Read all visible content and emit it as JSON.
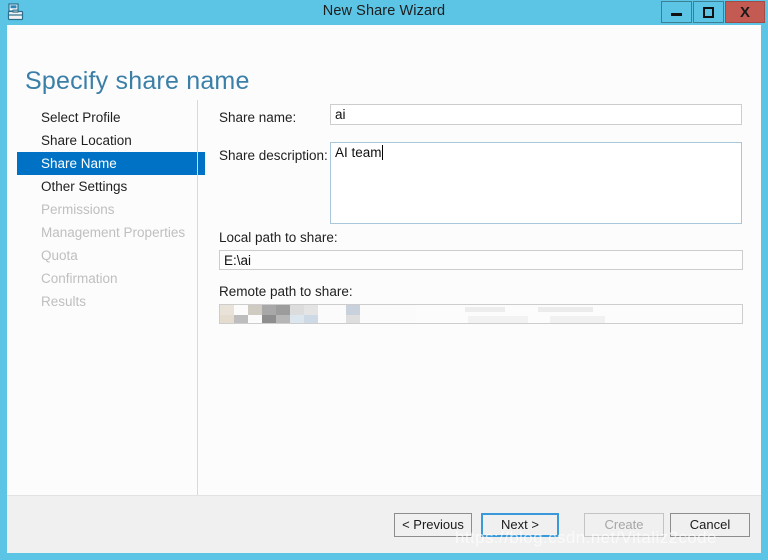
{
  "window": {
    "title": "New Share Wizard",
    "icon": "share-folder-icon",
    "accent_color": "#5cc4e4",
    "close_color": "#c45b52",
    "controls": {
      "minimize": "–",
      "maximize": "□",
      "close": "X"
    }
  },
  "page": {
    "heading": "Specify share name",
    "heading_color": "#3b7fa8"
  },
  "sidebar": {
    "selected_color": "#0072c6",
    "items": [
      {
        "label": "Select Profile",
        "state": "enabled"
      },
      {
        "label": "Share Location",
        "state": "enabled"
      },
      {
        "label": "Share Name",
        "state": "selected"
      },
      {
        "label": "Other Settings",
        "state": "enabled"
      },
      {
        "label": "Permissions",
        "state": "disabled"
      },
      {
        "label": "Management Properties",
        "state": "disabled"
      },
      {
        "label": "Quota",
        "state": "disabled"
      },
      {
        "label": "Confirmation",
        "state": "disabled"
      },
      {
        "label": "Results",
        "state": "disabled"
      }
    ]
  },
  "form": {
    "share_name": {
      "label": "Share name:",
      "value": "ai",
      "placeholder": ""
    },
    "share_description": {
      "label": "Share description:",
      "value": "AI team",
      "placeholder": ""
    },
    "local_path": {
      "label": "Local path to share:",
      "value": "E:\\ai",
      "readonly": true
    },
    "remote_path": {
      "label": "Remote path to share:",
      "value": "",
      "redacted": true,
      "note": "pixelated"
    }
  },
  "buttons": {
    "previous": "< Previous",
    "next": "Next >",
    "create": "Create",
    "cancel": "Cancel",
    "create_enabled": false,
    "next_focused": true
  },
  "watermark": {
    "text": "https://blog.csdn.net/Vitaliz2code"
  }
}
